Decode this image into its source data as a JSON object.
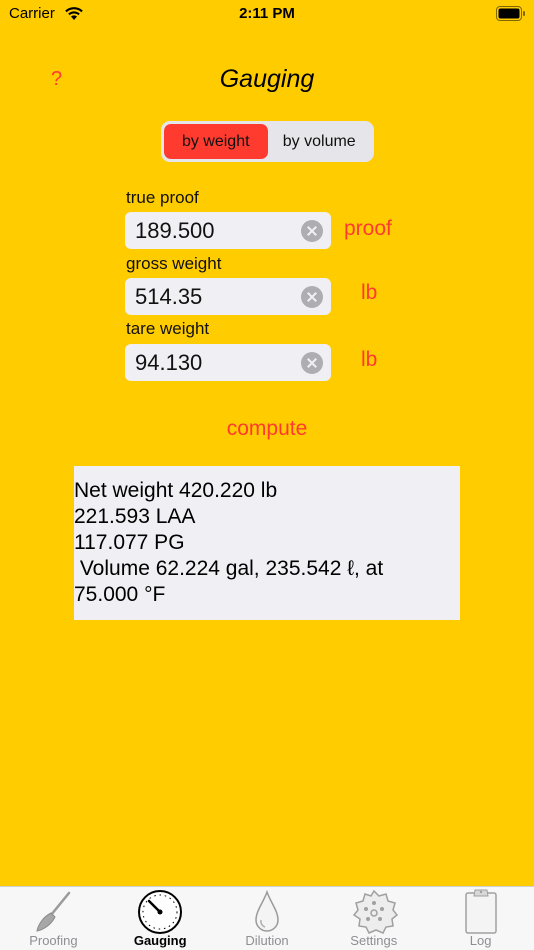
{
  "status_bar": {
    "carrier": "Carrier",
    "time": "2:11 PM"
  },
  "header": {
    "help_label": "?",
    "title": "Gauging"
  },
  "mode": {
    "options": [
      "by weight",
      "by volume"
    ],
    "selected": "by weight"
  },
  "fields": [
    {
      "label": "true proof",
      "value": "189.500",
      "unit": "proof"
    },
    {
      "label": "gross weight",
      "value": "514.35",
      "unit": "lb"
    },
    {
      "label": "tare weight",
      "value": "94.130",
      "unit": "lb"
    }
  ],
  "compute_label": "compute",
  "results": [
    "Net weight 420.220 lb",
    "221.593 LAA",
    "117.077 PG",
    " Volume 62.224 gal, 235.542 ℓ, at",
    "75.000 °F"
  ],
  "tabs": [
    {
      "label": "Proofing",
      "icon": "hydrometer-icon"
    },
    {
      "label": "Gauging",
      "icon": "gauge-icon"
    },
    {
      "label": "Dilution",
      "icon": "drop-icon"
    },
    {
      "label": "Settings",
      "icon": "gear-icon"
    },
    {
      "label": "Log",
      "icon": "clipboard-icon"
    }
  ],
  "active_tab": "Gauging",
  "colors": {
    "background": "#FFCC00",
    "accent": "#FF3B30",
    "field": "#EFEFF4"
  }
}
